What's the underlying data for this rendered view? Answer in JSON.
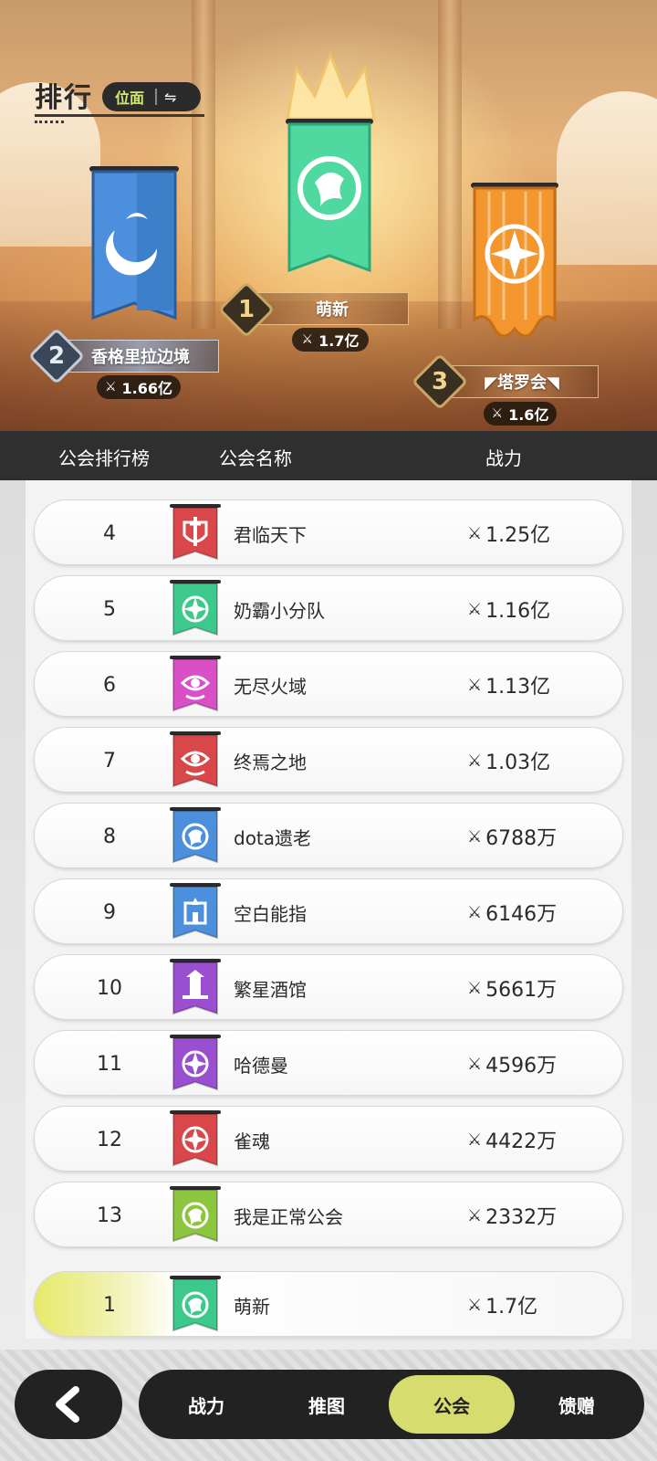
{
  "header": {
    "title": "排行",
    "toggle_label": "位面",
    "toggle_icon": "⇋"
  },
  "podium": {
    "first": {
      "rank": "1",
      "name": "萌新",
      "power": "1.7亿",
      "banner_color": "#4fd8a0",
      "emblem": "dragon-icon"
    },
    "second": {
      "rank": "2",
      "name": "香格里拉边境",
      "power": "1.66亿",
      "banner_color": "#4c8fdc",
      "emblem": "wave-moon-icon"
    },
    "third": {
      "rank": "3",
      "name": "◤塔罗会◥",
      "power": "1.6亿",
      "banner_color": "#f4962e",
      "emblem": "compass-star-icon"
    }
  },
  "table": {
    "col_rank": "公会排行榜",
    "col_name": "公会名称",
    "col_power": "战力"
  },
  "rows": [
    {
      "rank": "4",
      "name": "君临天下",
      "power": "1.25亿",
      "banner_color": "#d9474a",
      "emblem": "sword-shield-icon"
    },
    {
      "rank": "5",
      "name": "奶霸小分队",
      "power": "1.16亿",
      "banner_color": "#3ec98c",
      "emblem": "compass-star-icon"
    },
    {
      "rank": "6",
      "name": "无尽火域",
      "power": "1.13亿",
      "banner_color": "#d94fc6",
      "emblem": "eye-icon"
    },
    {
      "rank": "7",
      "name": "终焉之地",
      "power": "1.03亿",
      "banner_color": "#d9474a",
      "emblem": "eye-icon"
    },
    {
      "rank": "8",
      "name": "dota遗老",
      "power": "6788万",
      "banner_color": "#4c8fdc",
      "emblem": "dragon-icon"
    },
    {
      "rank": "9",
      "name": "空白能指",
      "power": "6146万",
      "banner_color": "#4c8fdc",
      "emblem": "castle-icon"
    },
    {
      "rank": "10",
      "name": "繁星酒馆",
      "power": "5661万",
      "banner_color": "#9a4fd0",
      "emblem": "tower-icon"
    },
    {
      "rank": "11",
      "name": "哈德曼",
      "power": "4596万",
      "banner_color": "#9a4fd0",
      "emblem": "compass-star-icon"
    },
    {
      "rank": "12",
      "name": "雀魂",
      "power": "4422万",
      "banner_color": "#d9474a",
      "emblem": "compass-star-icon"
    },
    {
      "rank": "13",
      "name": "我是正常公会",
      "power": "2332万",
      "banner_color": "#8cc63e",
      "emblem": "dragon-icon"
    }
  ],
  "my_guild": {
    "rank": "1",
    "name": "萌新",
    "power": "1.7亿",
    "banner_color": "#3ec98c",
    "emblem": "dragon-icon"
  },
  "nav": {
    "back_icon": "chevron-left-icon",
    "tabs": [
      {
        "label": "战力",
        "active": false
      },
      {
        "label": "推图",
        "active": false
      },
      {
        "label": "公会",
        "active": true
      },
      {
        "label": "馈赠",
        "active": false
      }
    ]
  },
  "icons": {
    "power": "crossed-swords-icon"
  }
}
